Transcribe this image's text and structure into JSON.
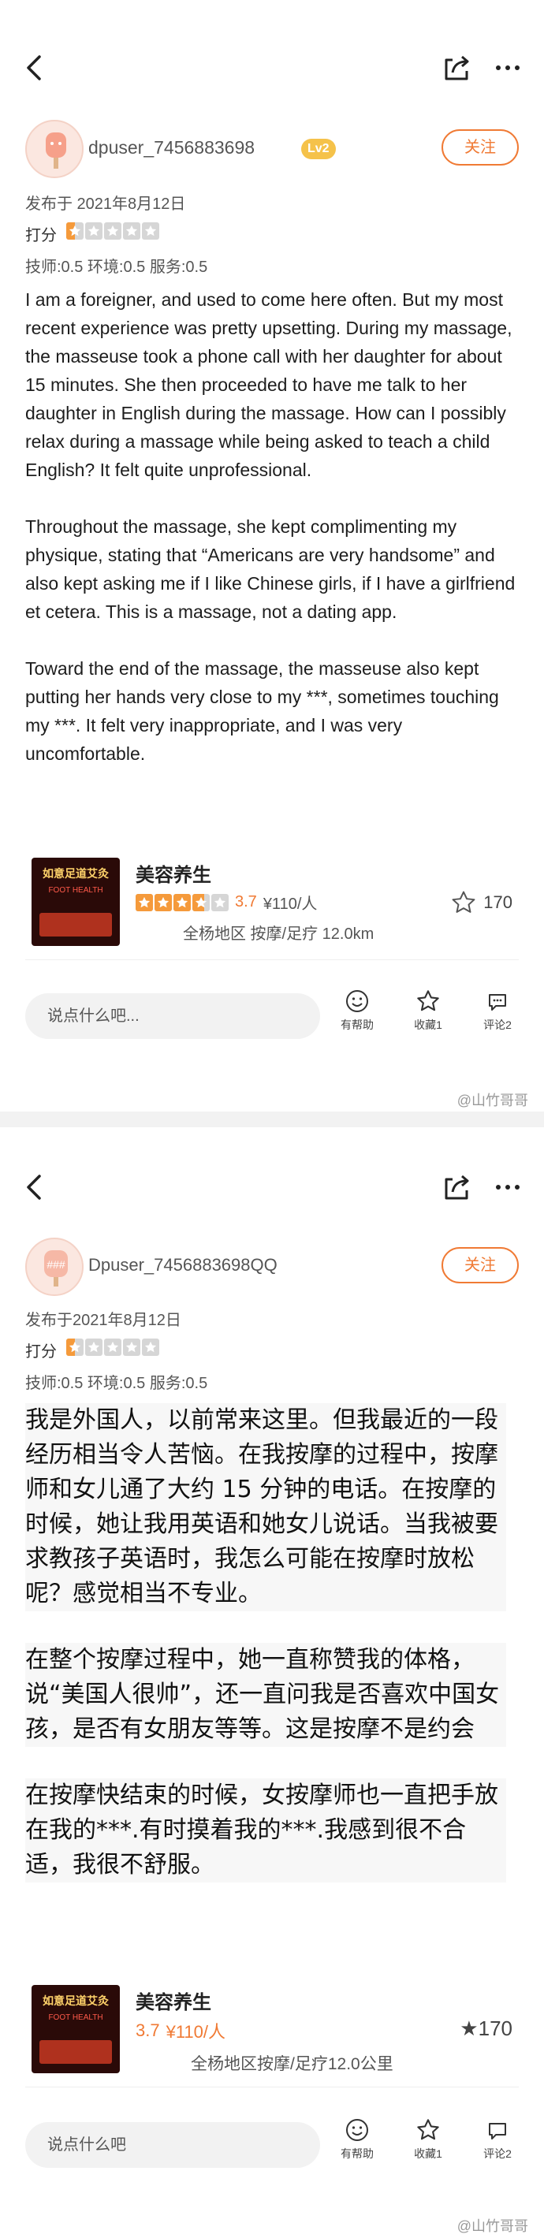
{
  "panels": [
    {
      "user": {
        "avatar_text": "",
        "username": "dpuser_7456883698",
        "level": "Lv2",
        "follow_label": "关注"
      },
      "published": "发布于 2021年8月12日",
      "rating_label": "打分",
      "rating_value": 0.5,
      "sub_scores": "技师:0.5   环境:0.5   服务:0.5",
      "paragraphs": [
        "I am a foreigner, and used to come here often. But my most recent experience was pretty upsetting. During my massage, the masseuse took a phone call with her daughter for about 15 minutes. She then proceeded to have me talk to her daughter in English during the massage. How can I possibly relax during a massage while being asked to teach a child English? It felt quite unprofessional.",
        "Throughout the massage, she kept complimenting my physique, stating that “Americans are very handsome” and also kept asking me if I like Chinese girls, if I have a girlfriend et cetera. This is a massage, not a dating app.",
        "Toward the end of the massage, the masseuse also kept putting her hands very close to my ***, sometimes touching my ***. It felt very inappropriate, and I was very uncomfortable."
      ],
      "shop": {
        "name": "美容养生",
        "thumb_sign": "如意足道艾灸",
        "thumb_sub": "FOOT HEALTH",
        "score": "3.7",
        "score_value": 3.7,
        "price": "¥110/人",
        "area": "全杨地区 按摩/足疗   12.0km",
        "fav_count": "170"
      },
      "bottom": {
        "placeholder": "说点什么吧...",
        "actions": [
          "有帮助",
          "收藏1",
          "评论2"
        ]
      },
      "watermark": "@山竹哥哥"
    },
    {
      "user": {
        "avatar_text": "###",
        "username": "Dpuser_7456883698QQ",
        "level": "",
        "follow_label": "关注"
      },
      "published": "发布于2021年8月12日",
      "rating_label": "打分",
      "rating_value": 0.5,
      "sub_scores": "技师:0.5 环境:0.5 服务:0.5",
      "paragraphs": [
        "我是外国人，以前常来这里。但我最近的一段经历相当令人苦恼。在我按摩的过程中，按摩师和女儿通了大约 15 分钟的电话。在按摩的时候，她让我用英语和她女儿说话。当我被要求教孩子英语时，我怎么可能在按摩时放松呢？感觉相当不专业。",
        "在整个按摩过程中，她一直称赞我的体格，说“美国人很帅”，还一直问我是否喜欢中国女孩，是否有女朋友等等。这是按摩不是约会",
        "在按摩快结束的时候，女按摩师也一直把手放在我的***.有时摸着我的***.我感到很不合适，我很不舒服。"
      ],
      "shop": {
        "name": "美容养生",
        "thumb_sign": "如意足道艾灸",
        "thumb_sub": "FOOT HEALTH",
        "score": "3.7",
        "score_value": 3.7,
        "price": "¥110/人",
        "area": "全杨地区按摩/足疗12.0公里",
        "fav_count": "★170"
      },
      "bottom": {
        "placeholder": "说点什么吧",
        "actions": [
          "有帮助",
          "收藏1",
          "评论2"
        ]
      },
      "watermark": "@山竹哥哥"
    }
  ],
  "colors": {
    "accent": "#f07a34",
    "star_fill": "#f59a3b",
    "star_empty": "#d6d6d6",
    "level_badge": "#f5c24a"
  }
}
